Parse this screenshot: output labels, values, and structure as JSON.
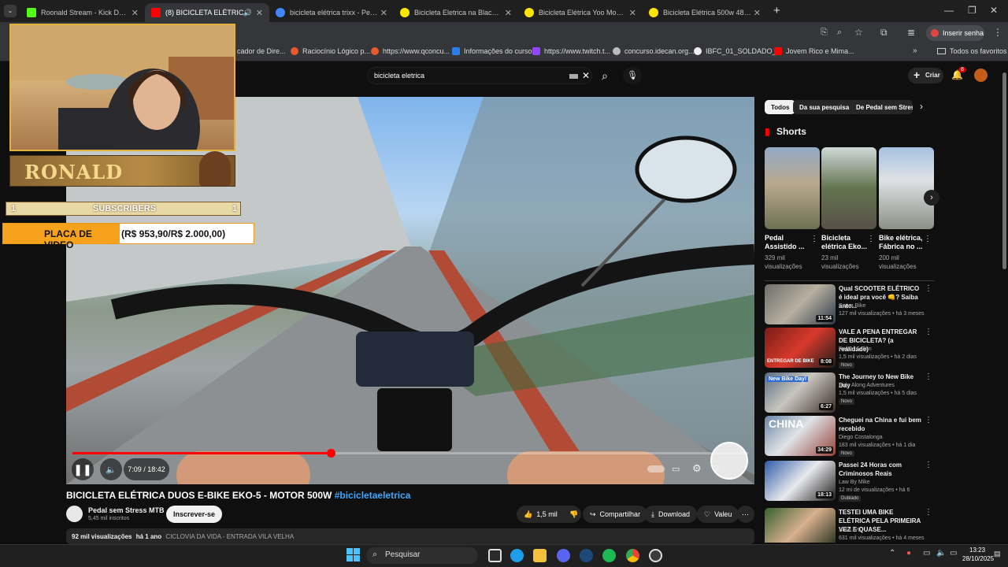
{
  "browser": {
    "tabs": [
      {
        "title": "Roonald Stream - Kick Dashbo",
        "color": "#53fc18"
      },
      {
        "title": "(8) BICICLETA ELÉTRICA DU",
        "color": "#ff0000"
      },
      {
        "title": "bicicleta elétrica trixx - Pesquis",
        "color": "#4285f4"
      },
      {
        "title": "Bicicleta Eletrica na Black Frida",
        "color": "#ffe600"
      },
      {
        "title": "Bicicleta Elétrica Yoo Mobility V",
        "color": "#ffe600"
      },
      {
        "title": "Bicicleta Elétrica 500w 48v Mini",
        "color": "#ffe600"
      }
    ],
    "password_button": "Inserir senha",
    "bookmarks": [
      {
        "label": "cador de Dire..."
      },
      {
        "label": "Raciocínio Lógico p..."
      },
      {
        "label": "https://www.qconcu..."
      },
      {
        "label": "Informações do curso"
      },
      {
        "label": "https://www.twitch.t..."
      },
      {
        "label": "concurso.idecan.org..."
      },
      {
        "label": "IBFC_01_SOLDADO_..."
      },
      {
        "label": "Jovem Rico e Mima..."
      }
    ],
    "all_favorites": "Todos os favoritos"
  },
  "youtube": {
    "search_value": "bicicleta eletrica",
    "create_label": "Criar",
    "notif_count": "8"
  },
  "overlay": {
    "streamer_name": "RONALD",
    "subs_left": "1",
    "subs_label": "SUBSCRIBERS",
    "subs_right": "1",
    "goal_label": "PLACA DE VIDEO",
    "goal_value": "(R$ 953,90/R$ 2.000,00)"
  },
  "player": {
    "time": "7:09 / 18:42",
    "progress_fraction": 0.382
  },
  "video": {
    "title": "BICICLETA ELÉTRICA DUOS E-BIKE EKO-5 - MOTOR 500W",
    "hashtag": "#bicicletaeletrica",
    "channel": "Pedal sem Stress MTB",
    "subscribers": "5,45 mil inscritos",
    "subscribe_label": "Inscrever-se",
    "likes": "1,5 mil",
    "share_label": "Compartilhar",
    "download_label": "Download",
    "thanks_label": "Valeu",
    "views": "92 mil visualizações",
    "age": "há 1 ano",
    "desc_snippet": "CICLOVIA DA VIDA - ENTRADA VILA VELHA"
  },
  "sidebar": {
    "chips": [
      {
        "label": "Todos"
      },
      {
        "label": "Da sua pesquisa"
      },
      {
        "label": "De Pedal sem Stress"
      }
    ],
    "shorts_title": "Shorts",
    "shorts": [
      {
        "title": "Pedal Assistido ...",
        "views": "329 mil visualizações"
      },
      {
        "title": "Bicicleta elétrica Eko...",
        "views": "23 mil visualizações"
      },
      {
        "title": "Bike elétrica, Fábrica no ...",
        "views": "200 mil visualizações"
      }
    ],
    "recs": [
      {
        "title": "Qual SCOOTER ELÉTRICO é ideal pra você 👊? Saiba ante...",
        "channel": "Supra Bike",
        "meta": "127 mil visualizações • há 3 meses",
        "dur": "11:54",
        "badge": ""
      },
      {
        "title": "VALE A PENA ENTREGAR DE BICICLETA? (a realidade)",
        "channel": "Rafael Sallen",
        "meta": "1,5 mil visualizações • há 2 dias",
        "dur": "8:08",
        "badge": "Novo",
        "thumb_text": "ENTREGAR DE BIKE"
      },
      {
        "title": "The Journey to New Bike Day",
        "channel": "Ride Along Adventures",
        "meta": "1,5 mil visualizações • há 5 dias",
        "dur": "6:27",
        "badge": "Novo",
        "thumb_text": "New Bike Day!"
      },
      {
        "title": "Cheguei na China e fui bem recebido",
        "channel": "Diego Costalonga",
        "meta": "183 mil visualizações • há 1 dia",
        "dur": "34:29",
        "badge": "Novo",
        "thumb_text": "CHINA"
      },
      {
        "title": "Passei 24 Horas com Criminosos Reais",
        "channel": "Law By Mike",
        "meta": "12 mi de visualizações • há 6 meses",
        "dur": "18:13",
        "badge": "Dublado"
      },
      {
        "title": "TESTEI UMA BIKE ELÉTRICA PELA PRIMEIRA VEZ E QUASE...",
        "channel": "SolaLIVE",
        "meta": "631 mil visualizações • há 4 meses",
        "dur": "",
        "badge": ""
      }
    ]
  },
  "taskbar": {
    "search_label": "Pesquisar",
    "time": "13:23",
    "date": "28/10/2025"
  }
}
